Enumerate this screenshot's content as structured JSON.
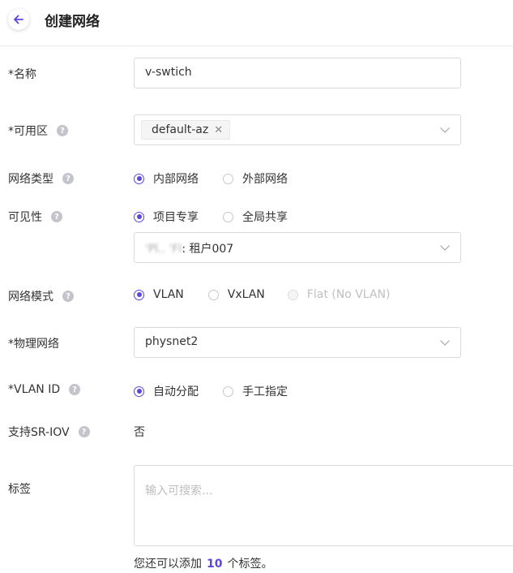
{
  "header": {
    "title": "创建网络"
  },
  "form": {
    "name": {
      "label": "*名称",
      "value": "v-swtich"
    },
    "availability_zone": {
      "label": "*可用区",
      "tag": "default-az"
    },
    "network_type": {
      "label": "网络类型",
      "options": [
        "内部网络",
        "外部网络"
      ],
      "selected": 0
    },
    "visibility": {
      "label": "可见性",
      "options": [
        "项目专享",
        "全局共享"
      ],
      "selected": 0,
      "project_prefix": "'Pl.. 'Fl",
      "project_value": ": 租户007"
    },
    "network_mode": {
      "label": "网络模式",
      "options": [
        "VLAN",
        "VxLAN",
        "Flat (No VLAN)"
      ],
      "selected": 0,
      "disabled": [
        2
      ]
    },
    "physical_network": {
      "label": "*物理网络",
      "value": "physnet2"
    },
    "vlan_id": {
      "label": "*VLAN ID",
      "options": [
        "自动分配",
        "手工指定"
      ],
      "selected": 0
    },
    "sriov": {
      "label": "支持SR-IOV",
      "value": "否"
    },
    "tags": {
      "label": "标签",
      "placeholder": "输入可搜索...",
      "hint_prefix": "您还可以添加",
      "hint_count": "10",
      "hint_suffix": "个标签。"
    }
  },
  "colors": {
    "accent": "#5b47e0",
    "border": "#d9d9d9"
  }
}
